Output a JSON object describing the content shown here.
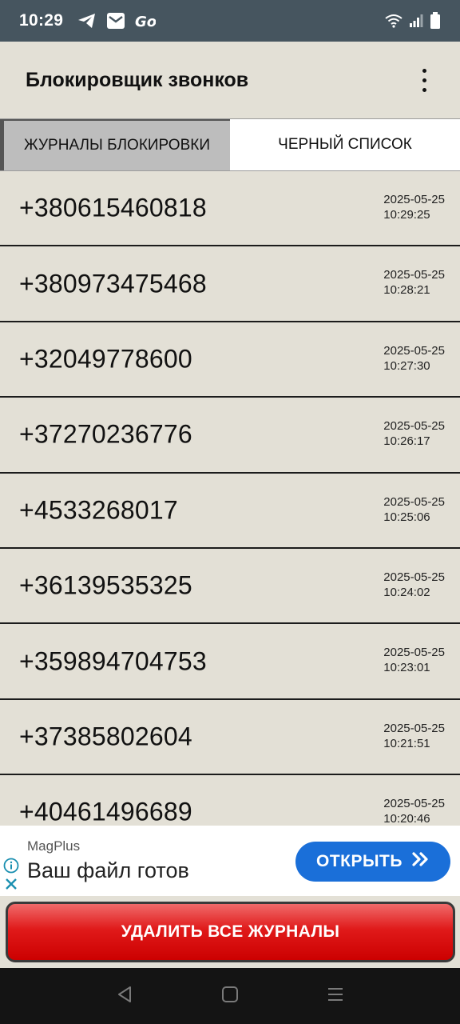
{
  "status_bar": {
    "time": "10:29",
    "notifications": [
      "telegram-icon",
      "mail-icon",
      "go-icon"
    ],
    "system": [
      "wifi-icon",
      "signal-icon",
      "battery-icon"
    ]
  },
  "app_bar": {
    "title": "Блокировщик звонков",
    "menu_icon": "more-vert-icon"
  },
  "tabs": [
    {
      "label": "ЖУРНАЛЫ БЛОКИРОВКИ",
      "active": true
    },
    {
      "label": "ЧЕРНЫЙ СПИСОК",
      "active": false
    }
  ],
  "logs": [
    {
      "number": "+380615460818",
      "date": "2025-05-25",
      "time": "10:29:25"
    },
    {
      "number": "+380973475468",
      "date": "2025-05-25",
      "time": "10:28:21"
    },
    {
      "number": "+32049778600",
      "date": "2025-05-25",
      "time": "10:27:30"
    },
    {
      "number": "+37270236776",
      "date": "2025-05-25",
      "time": "10:26:17"
    },
    {
      "number": "+4533268017",
      "date": "2025-05-25",
      "time": "10:25:06"
    },
    {
      "number": "+36139535325",
      "date": "2025-05-25",
      "time": "10:24:02"
    },
    {
      "number": "+359894704753",
      "date": "2025-05-25",
      "time": "10:23:01"
    },
    {
      "number": "+37385802604",
      "date": "2025-05-25",
      "time": "10:21:51"
    },
    {
      "number": "+40461496689",
      "date": "2025-05-25",
      "time": "10:20:46"
    }
  ],
  "ad": {
    "brand": "MagPlus",
    "headline": "Ваш файл готов",
    "button_label": "ОТКРЫТЬ"
  },
  "delete_button": {
    "label": "УДАЛИТЬ ВСЕ ЖУРНАЛЫ"
  },
  "nav_bar": [
    "back-icon",
    "home-icon",
    "recents-icon"
  ],
  "colors": {
    "status_bar_bg": "#46555f",
    "app_bg": "#e3e0d6",
    "active_tab_bg": "#bdbdbd",
    "ad_button": "#1a6fd9",
    "delete_button": "#e01a1a",
    "nav_bar_bg": "#141414"
  }
}
